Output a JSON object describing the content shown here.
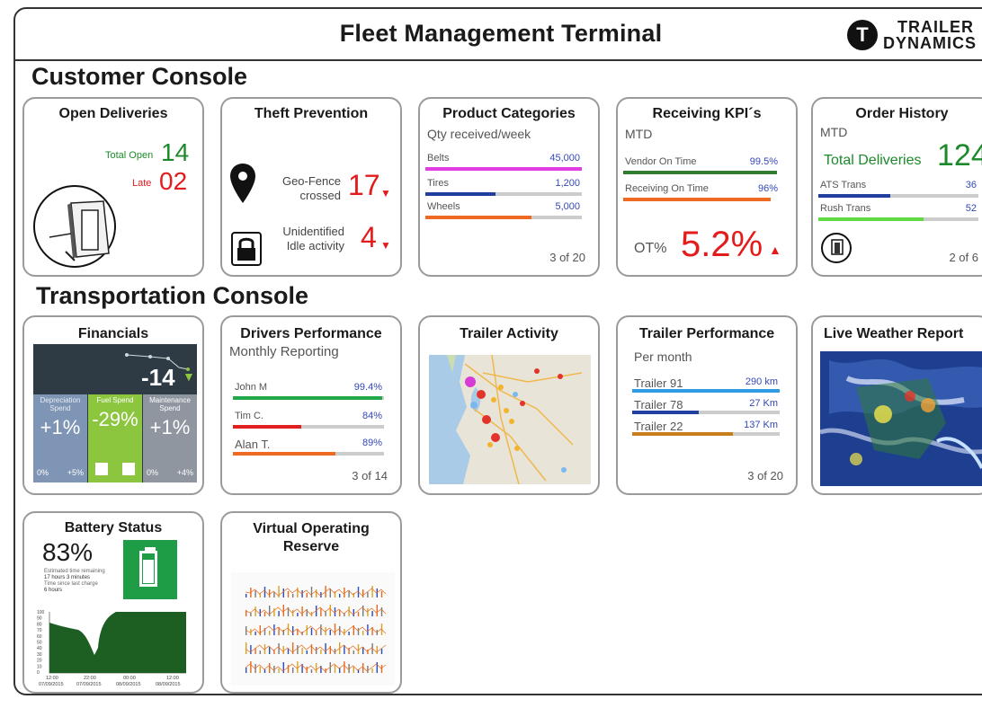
{
  "header": {
    "title": "Fleet Management Terminal",
    "logo_line1": "TRAILER",
    "logo_line2": "DYNAMICS"
  },
  "customer": {
    "section_title": "Customer Console",
    "open_deliveries": {
      "title": "Open Deliveries",
      "total_label": "Total Open",
      "total_value": "14",
      "late_label": "Late",
      "late_value": "02"
    },
    "theft": {
      "title": "Theft Prevention",
      "geo_label_1": "Geo-Fence",
      "geo_label_2": "crossed",
      "geo_value": "17",
      "idle_label_1": "Unidentified",
      "idle_label_2": "Idle activity",
      "idle_value": "4"
    },
    "product": {
      "title": "Product Categories",
      "subtitle": "Qty received/week",
      "rows": [
        {
          "label": "Belts",
          "value": "45,000",
          "fill": 1.0,
          "color": "#e23de0"
        },
        {
          "label": "Tires",
          "value": "1,200",
          "fill": 0.45,
          "color": "#1f3e9e"
        },
        {
          "label": "Wheels",
          "value": "5,000",
          "fill": 0.68,
          "color": "#ee6a22"
        }
      ],
      "pager": "3 of 20"
    },
    "kpi": {
      "title": "Receiving KPI´s",
      "subtitle": "MTD",
      "rows": [
        {
          "label": "Vendor On Time",
          "value": "99.5%",
          "fill": 0.98,
          "color": "#2e7d32"
        },
        {
          "label": "Receiving On Time",
          "value": "96%",
          "fill": 0.94,
          "color": "#ee6a22"
        }
      ],
      "ot_label": "OT%",
      "ot_value": "5.2%"
    },
    "orders": {
      "title": "Order History",
      "subtitle": "MTD",
      "total_label": "Total Deliveries",
      "total_value": "124",
      "rows": [
        {
          "label": "ATS Trans",
          "value": "36",
          "fill": 0.45,
          "color": "#1f3e9e"
        },
        {
          "label": "Rush Trans",
          "value": "52",
          "fill": 0.66,
          "color": "#5fdc45"
        }
      ],
      "pager": "2 of 6"
    }
  },
  "transport": {
    "section_title": "Transportation Console",
    "financials": {
      "title": "Financials",
      "headline": "-14",
      "tiles": [
        {
          "name": "Depreciation Spend",
          "value": "+1%",
          "foot_left": "0%",
          "foot_right": "+5%",
          "color": "#7f95b5"
        },
        {
          "name": "Fuel Spend",
          "value": "-29%",
          "foot_left": "",
          "foot_right": "",
          "color": "#8cc63f"
        },
        {
          "name": "Maintenance Spend",
          "value": "+1%",
          "foot_left": "0%",
          "foot_right": "+4%",
          "color": "#8f96a0"
        }
      ]
    },
    "drivers": {
      "title": "Drivers Performance",
      "subtitle": "Monthly Reporting",
      "rows": [
        {
          "label": "John M",
          "value": "99.4%",
          "fill": 0.99,
          "color": "#1fa84a"
        },
        {
          "label": "Tim C.",
          "value": "84%",
          "fill": 0.45,
          "color": "#e02020"
        },
        {
          "label": "Alan T.",
          "value": "89%",
          "fill": 0.68,
          "color": "#ee6a22"
        }
      ],
      "pager": "3 of 14"
    },
    "trailer_activity": {
      "title": "Trailer Activity"
    },
    "trailer_perf": {
      "title": "Trailer Performance",
      "subtitle": "Per month",
      "rows": [
        {
          "label": "Trailer 91",
          "value": "290 km",
          "fill": 1.0,
          "color": "#2f9be0"
        },
        {
          "label": "Trailer 78",
          "value": "27 Km",
          "fill": 0.45,
          "color": "#1f3e9e"
        },
        {
          "label": "Trailer 22",
          "value": "137 Km",
          "fill": 0.68,
          "color": "#c77f1c"
        }
      ],
      "pager": "3 of 20"
    },
    "weather": {
      "title": "Live Weather Report"
    },
    "battery": {
      "title": "Battery Status",
      "percent": "83%",
      "line1": "Estimated time remaining",
      "line2": "17 hours 3 minutes",
      "line3": "Time since last charge",
      "line4": "6 hours",
      "x_ticks": [
        "12:00",
        "22:00",
        "00:00",
        "12:00"
      ],
      "x_dates": [
        "07/09/2015",
        "07/09/2015",
        "08/09/2015",
        "08/09/2015"
      ],
      "y_ticks": [
        "100",
        "90",
        "80",
        "70",
        "60",
        "50",
        "40",
        "30",
        "20",
        "10",
        "0"
      ]
    },
    "vor": {
      "title_line1": "Virtual Operating",
      "title_line2": "Reserve"
    }
  },
  "icons": [
    "location-pin-icon",
    "lock-icon",
    "trailer-icon",
    "battery-icon",
    "down-arrow-icon",
    "up-arrow-icon"
  ]
}
